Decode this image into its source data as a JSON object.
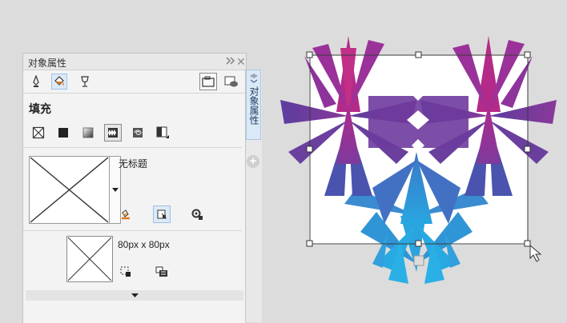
{
  "panel": {
    "title": "对象属性",
    "forward_icon": "double-chevron-right-icon",
    "close_label": "✕",
    "toolbar": [
      "outline-pen-icon",
      "fill-bucket-icon",
      "transparency-glass-icon",
      "summary-tab-icon",
      "view-frame-icon"
    ],
    "fill": {
      "section_title": "填充",
      "types": [
        "no-fill",
        "uniform-fill",
        "fountain-fill",
        "vector-pattern-fill",
        "bitmap-pattern-fill",
        "two-color-pattern-fill"
      ],
      "active_type": "vector-pattern-fill",
      "pattern_name": "无标题",
      "tile_size": "80px x 80px"
    }
  },
  "side_tabs": {
    "active_tab": "对象属性",
    "add_label": "+"
  },
  "canvas": {
    "colors": {
      "magenta": "#b02d8f",
      "purple": "#6a3b9b",
      "blue": "#2f9bd8",
      "selection": "#3a3a3a"
    }
  }
}
